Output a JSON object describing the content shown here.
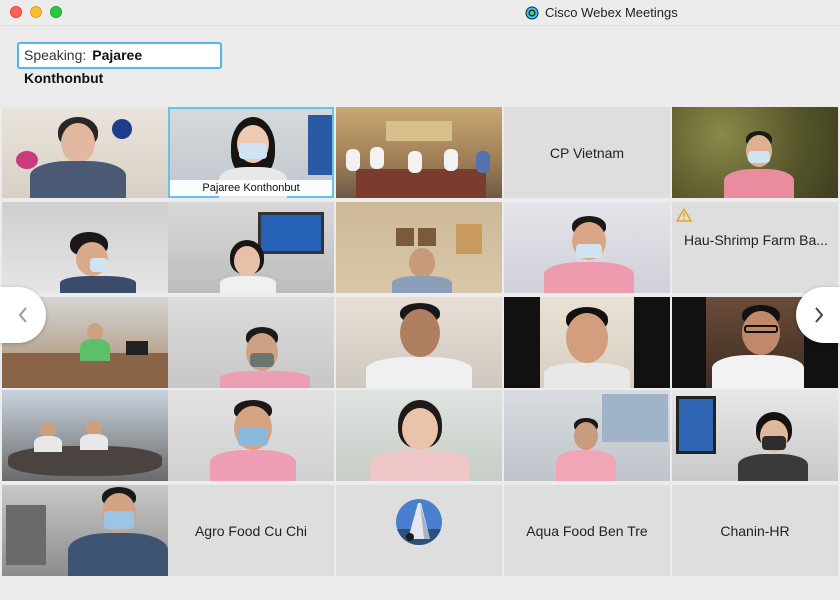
{
  "window": {
    "app_title": "Cisco Webex Meetings"
  },
  "speaking": {
    "label": "Speaking:",
    "name": "Pajaree Konthonbut"
  },
  "nav": {
    "prev_icon": "chevron-left-icon",
    "next_icon": "chevron-right-icon"
  },
  "tiles": [
    {
      "name": "",
      "type": "video"
    },
    {
      "name": "Pajaree Konthonbut",
      "type": "video",
      "active": true
    },
    {
      "name": "",
      "type": "video"
    },
    {
      "name": "CP Vietnam",
      "type": "name"
    },
    {
      "name": "",
      "type": "video"
    },
    {
      "name": "",
      "type": "video"
    },
    {
      "name": "",
      "type": "video"
    },
    {
      "name": "",
      "type": "video"
    },
    {
      "name": "",
      "type": "video"
    },
    {
      "name": "Hau-Shrimp Farm Ba...",
      "type": "warning"
    },
    {
      "name": "",
      "type": "video"
    },
    {
      "name": "",
      "type": "video"
    },
    {
      "name": "",
      "type": "video"
    },
    {
      "name": "",
      "type": "video"
    },
    {
      "name": "",
      "type": "video"
    },
    {
      "name": "",
      "type": "video"
    },
    {
      "name": "",
      "type": "video"
    },
    {
      "name": "",
      "type": "video"
    },
    {
      "name": "",
      "type": "video"
    },
    {
      "name": "",
      "type": "video"
    },
    {
      "name": "",
      "type": "video"
    },
    {
      "name": "Agro Food Cu Chi",
      "type": "name"
    },
    {
      "name": "",
      "type": "avatar"
    },
    {
      "name": "Aqua Food Ben Tre",
      "type": "name"
    },
    {
      "name": "Chanin-HR",
      "type": "name"
    }
  ],
  "colors": {
    "accent": "#63c2ee",
    "close": "#fe5f57",
    "minimize": "#febc2e",
    "maximize": "#28c840"
  }
}
